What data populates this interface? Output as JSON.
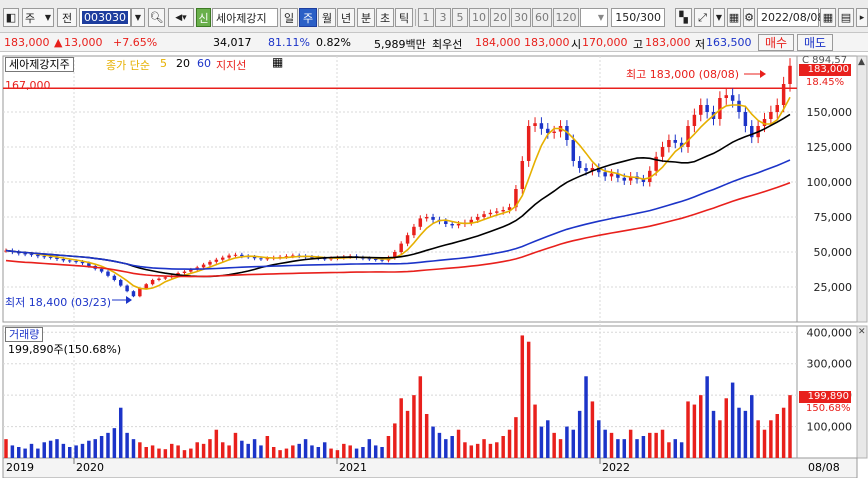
{
  "toolbar": {
    "market_select": "주",
    "code_type": "전",
    "stock_code": "003030",
    "stock_badge": "신",
    "stock_name": "세아제강지",
    "periods": [
      "일",
      "주",
      "월",
      "년",
      "분",
      "초",
      "틱"
    ],
    "active_period": "주",
    "intervals": [
      "1",
      "3",
      "5",
      "10",
      "20",
      "30",
      "60",
      "120"
    ],
    "count_display": "150/300",
    "date": "2022/08/08"
  },
  "quote": {
    "price": "183,000",
    "change_arrow": "▲",
    "change": "13,000",
    "change_pct": "+7.65%",
    "volume": "34,017",
    "vol_ratio": "81.11%",
    "turnover": "0.82%",
    "amount": "5,989백만",
    "best_ask_label": "최우선",
    "best_ask": "184,000",
    "best_bid": "183,000",
    "open_label": "시",
    "open": "170,000",
    "high_label": "고",
    "high": "183,000",
    "low_label": "저",
    "low": "163,500",
    "buy_label": "매수",
    "sell_label": "매도"
  },
  "colors": {
    "up": "#e8201c",
    "down": "#1c34c8",
    "ma5": "#e6b000",
    "ma20": "#000000",
    "ma60": "#1c34c8",
    "support": "#e8201c"
  },
  "price_pane": {
    "title": "세아제강지주",
    "ma_label": "종가 단순",
    "ma_periods": [
      "5",
      "20",
      "60"
    ],
    "support_label": "지지선",
    "support_value": "167,000",
    "max_note": "최고 183,000 (08/08)",
    "min_note": "최저 18,400 (03/23)",
    "right_partial_top": "C 894,57",
    "right_price_badge": "183,000",
    "right_pct": "18.45%"
  },
  "volume_pane": {
    "title": "거래량",
    "current_label": "199,890주(150.68%)",
    "right_value_badge": "199,890",
    "right_pct": "150.68%"
  },
  "x_axis": {
    "labels": [
      "2019",
      "2020",
      "2021",
      "2022"
    ],
    "last_label": "08/08"
  },
  "chart_data": [
    {
      "type": "candlestick",
      "title": "세아제강지주",
      "ylim": [
        0,
        190000
      ],
      "y_ticks": [
        "25,000",
        "50,000",
        "75,000",
        "100,000",
        "125,000",
        "150,000"
      ],
      "support_line": 167000,
      "series": [
        {
          "name": "5",
          "values": []
        },
        {
          "name": "20",
          "values": []
        },
        {
          "name": "60",
          "values": []
        }
      ],
      "weekly_close": [
        51000,
        50000,
        49000,
        48500,
        48000,
        47000,
        46500,
        46000,
        45000,
        44000,
        43500,
        43000,
        42000,
        40000,
        38000,
        36000,
        33000,
        30000,
        26000,
        22000,
        18400,
        24000,
        27000,
        30000,
        31000,
        32000,
        33000,
        35000,
        36000,
        37500,
        39000,
        41000,
        43000,
        44500,
        46000,
        47500,
        48000,
        47000,
        46500,
        45500,
        45000,
        45500,
        46000,
        46500,
        47000,
        47500,
        47000,
        46500,
        46000,
        45500,
        45000,
        45500,
        46000,
        46500,
        47000,
        46000,
        45500,
        45000,
        44500,
        44000,
        46000,
        50000,
        56000,
        62000,
        68000,
        74000,
        75000,
        73000,
        72000,
        70000,
        69000,
        70000,
        71000,
        73000,
        75000,
        77000,
        78000,
        79000,
        80000,
        82000,
        95000,
        115000,
        140000,
        142000,
        138000,
        135000,
        136000,
        140000,
        130000,
        115000,
        110000,
        108000,
        110000,
        107000,
        104000,
        106000,
        103000,
        101000,
        104000,
        102000,
        100000,
        108000,
        118000,
        125000,
        130000,
        128000,
        125000,
        140000,
        148000,
        155000,
        150000,
        145000,
        160000,
        162000,
        158000,
        150000,
        140000,
        132000,
        140000,
        145000,
        150000,
        155000,
        170000,
        183000
      ],
      "volume_weekly_thousands": [
        60,
        40,
        35,
        30,
        45,
        30,
        50,
        55,
        60,
        45,
        35,
        40,
        45,
        55,
        60,
        70,
        80,
        95,
        160,
        80,
        60,
        50,
        35,
        40,
        30,
        28,
        45,
        40,
        25,
        30,
        50,
        45,
        60,
        90,
        50,
        40,
        80,
        55,
        45,
        60,
        40,
        70,
        35,
        25,
        30,
        40,
        45,
        60,
        40,
        35,
        50,
        30,
        25,
        45,
        40,
        30,
        35,
        60,
        40,
        35,
        70,
        110,
        190,
        150,
        200,
        260,
        140,
        100,
        80,
        60,
        70,
        90,
        50,
        40,
        45,
        60,
        45,
        50,
        70,
        90,
        130,
        390,
        370,
        170,
        100,
        120,
        80,
        60,
        100,
        90,
        150,
        260,
        180,
        120,
        90,
        80,
        60,
        60,
        90,
        60,
        70,
        80,
        80,
        90,
        50,
        60,
        50,
        180,
        170,
        200,
        260,
        150,
        120,
        190,
        240,
        160,
        150,
        200,
        120,
        90,
        120,
        140,
        160,
        200
      ]
    }
  ]
}
